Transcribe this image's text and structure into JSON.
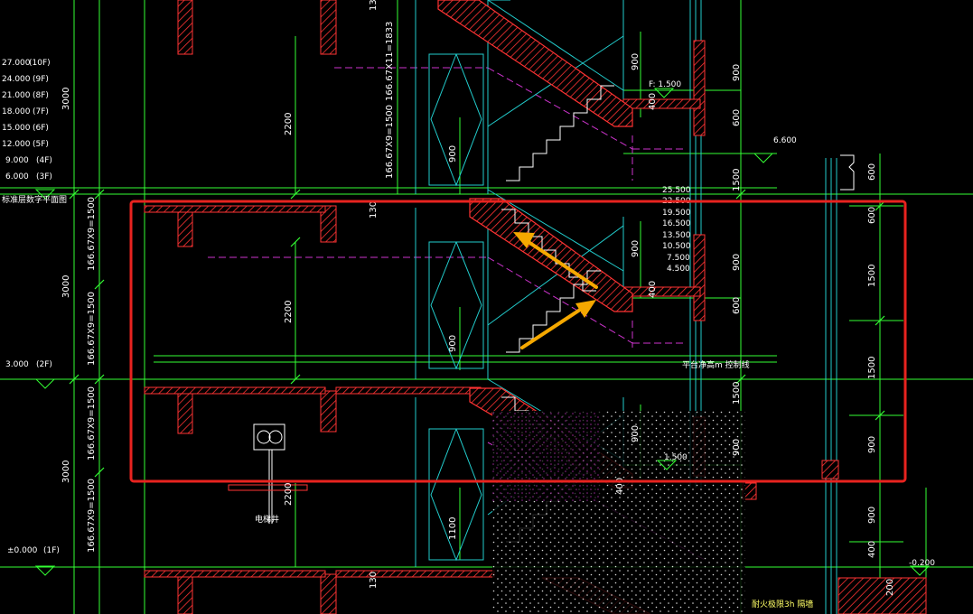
{
  "colors": {
    "background": "#000000",
    "wall": "#ff3333",
    "dimension": "#33ff33",
    "text": "#ffffff",
    "yellow_text": "#ffff66",
    "cyan": "#22cccc",
    "magenta": "#cc33cc",
    "highlight": "#e8231f",
    "arrow": "#f5a800"
  },
  "floor_levels": [
    {
      "label": "27.000",
      "floor": "(10F)"
    },
    {
      "label": "24.000",
      "floor": "(9F)"
    },
    {
      "label": "21.000",
      "floor": "(8F)"
    },
    {
      "label": "18.000",
      "floor": "(7F)"
    },
    {
      "label": "15.000",
      "floor": "(6F)"
    },
    {
      "label": "12.000",
      "floor": "(5F)"
    },
    {
      "label": "9.000",
      "floor": "(4F)"
    },
    {
      "label": "6.000",
      "floor": "(3F)"
    }
  ],
  "left_annotations": {
    "plan_note": "标准层数字平面图",
    "level_3000": "3.000",
    "floor_2f": "(2F)",
    "level_0": "±0.000",
    "floor_1f": "(1F)",
    "height_3000": "3000",
    "stair_spec_1500": "166.67X9=1500",
    "stair_spec_1833": "166.67X11=1833",
    "elevator_shaft": "电梯井"
  },
  "landing_elevations": [
    "25.500",
    "22.500",
    "19.500",
    "16.500",
    "13.500",
    "10.500",
    "7.500",
    "4.500"
  ],
  "dims": {
    "d130": "130",
    "d2200": "2200",
    "d900": "900",
    "d400": "400",
    "d600": "600",
    "d1500": "1500",
    "d1100": "1100",
    "d200": "200"
  },
  "right_annotations": {
    "level_6600": "6.600",
    "level_1500_top": "F: 1.500",
    "level_1500": "1.500",
    "level_minus_0200": "-0.200",
    "clear_height_line": "平台净高m 控制线",
    "fire_wall": "耐火极限3h 隔墙"
  }
}
